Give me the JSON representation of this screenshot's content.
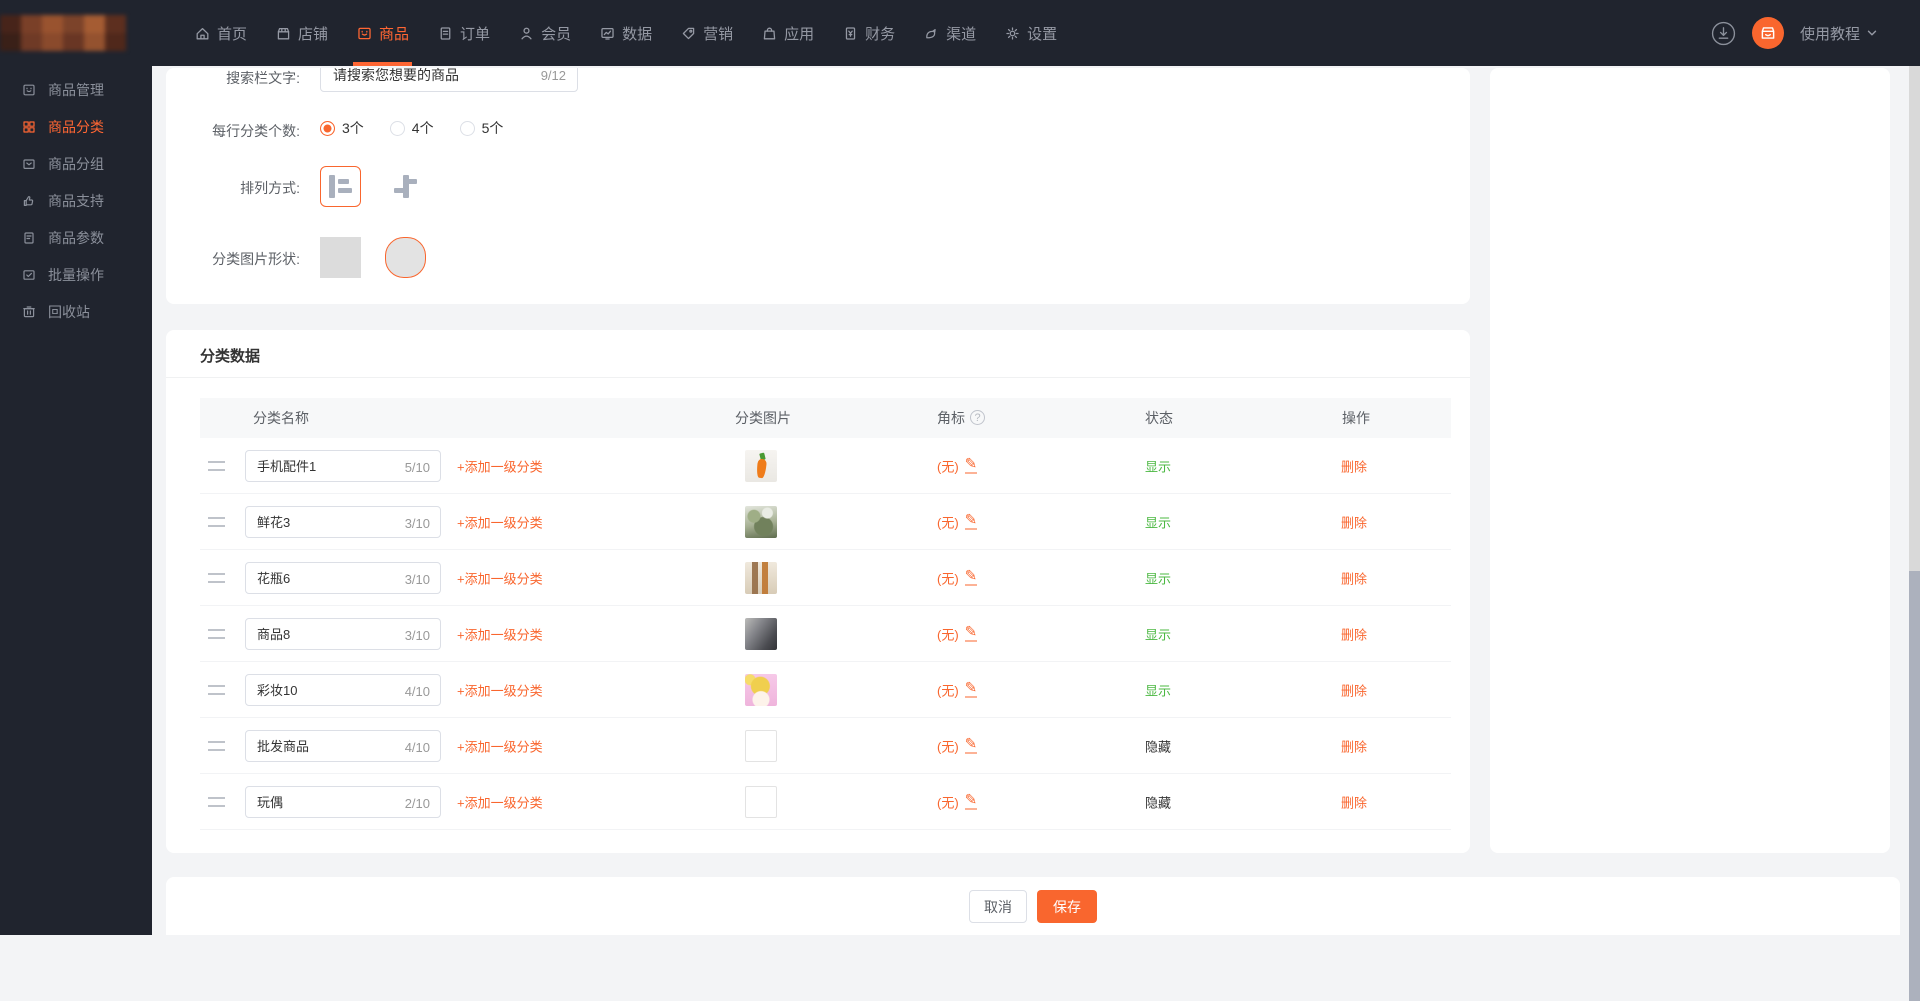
{
  "colors": {
    "accent": "#f9662e",
    "green": "#4bb842",
    "navbar_bg": "#20242e"
  },
  "topnav": {
    "items": [
      {
        "id": "home",
        "label": "首页",
        "active": false
      },
      {
        "id": "shop",
        "label": "店铺",
        "active": false
      },
      {
        "id": "goods",
        "label": "商品",
        "active": true
      },
      {
        "id": "orders",
        "label": "订单",
        "active": false
      },
      {
        "id": "members",
        "label": "会员",
        "active": false
      },
      {
        "id": "data",
        "label": "数据",
        "active": false
      },
      {
        "id": "marketing",
        "label": "营销",
        "active": false
      },
      {
        "id": "apps",
        "label": "应用",
        "active": false
      },
      {
        "id": "finance",
        "label": "财务",
        "active": false
      },
      {
        "id": "channels",
        "label": "渠道",
        "active": false
      },
      {
        "id": "settings",
        "label": "设置",
        "active": false
      }
    ],
    "tutorial_label": "使用教程"
  },
  "sidebar": {
    "items": [
      {
        "id": "goods-manage",
        "label": "商品管理",
        "active": false
      },
      {
        "id": "goods-category",
        "label": "商品分类",
        "active": true
      },
      {
        "id": "goods-group",
        "label": "商品分组",
        "active": false
      },
      {
        "id": "goods-support",
        "label": "商品支持",
        "active": false
      },
      {
        "id": "goods-params",
        "label": "商品参数",
        "active": false
      },
      {
        "id": "batch-ops",
        "label": "批量操作",
        "active": false
      },
      {
        "id": "recycle-bin",
        "label": "回收站",
        "active": false
      }
    ]
  },
  "form": {
    "search_label": "搜索栏文字:",
    "search_value": "请搜索您想要的商品",
    "search_counter": "9/12",
    "per_row_label": "每行分类个数:",
    "per_row_options": [
      {
        "label": "3个",
        "selected": true
      },
      {
        "label": "4个",
        "selected": false
      },
      {
        "label": "5个",
        "selected": false
      }
    ],
    "arrange_label": "排列方式:",
    "shape_label": "分类图片形状:"
  },
  "table": {
    "section_title": "分类数据",
    "headers": [
      "分类名称",
      "分类图片",
      "角标",
      "状态",
      "操作"
    ],
    "add_link_label": "+添加一级分类",
    "badge_none_label": "(无)",
    "delete_label": "删除",
    "rows": [
      {
        "name": "手机配件1",
        "counter": "5/10",
        "image": "carrot-toy-photo",
        "status": "显示",
        "visible": true
      },
      {
        "name": "鲜花3",
        "counter": "3/10",
        "image": "flowers-photo",
        "status": "显示",
        "visible": true
      },
      {
        "name": "花瓶6",
        "counter": "3/10",
        "image": "vases-photo",
        "status": "显示",
        "visible": true
      },
      {
        "name": "商品8",
        "counter": "3/10",
        "image": "gray-plant-photo",
        "status": "显示",
        "visible": true
      },
      {
        "name": "彩妆10",
        "counter": "4/10",
        "image": "pink-cartoon-photo",
        "status": "显示",
        "visible": true
      },
      {
        "name": "批发商品",
        "counter": "4/10",
        "image": "none",
        "status": "隐藏",
        "visible": false
      },
      {
        "name": "玩偶",
        "counter": "2/10",
        "image": "none",
        "status": "隐藏",
        "visible": false
      }
    ]
  },
  "footer": {
    "cancel_label": "取消",
    "save_label": "保存"
  }
}
